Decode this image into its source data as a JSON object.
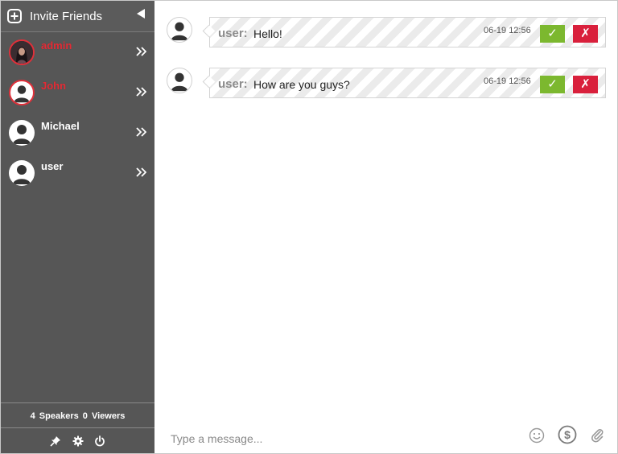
{
  "sidebar": {
    "invite_label": "Invite Friends",
    "users": [
      {
        "name": "admin",
        "highlight": true
      },
      {
        "name": "John",
        "highlight": true
      },
      {
        "name": "Michael",
        "highlight": false
      },
      {
        "name": "user",
        "highlight": false
      }
    ],
    "stats": {
      "speakers_count": "4",
      "speakers_label": "Speakers",
      "viewers_count": "0",
      "viewers_label": "Viewers"
    }
  },
  "messages": [
    {
      "user": "user:",
      "text": "Hello!",
      "time": "06-19 12:56",
      "accept": "✓",
      "reject": "✗"
    },
    {
      "user": "user:",
      "text": "How are you guys?",
      "time": "06-19 12:56",
      "accept": "✓",
      "reject": "✗"
    }
  ],
  "composer": {
    "placeholder": "Type a message..."
  },
  "colors": {
    "sidebar_bg": "#565656",
    "highlight_name": "#e52b35",
    "accept_green": "#7cb82f",
    "reject_red": "#d9203c"
  },
  "icons": [
    "plus-icon",
    "collapse-arrow-icon",
    "chevron-right-icon",
    "pin-icon",
    "gear-icon",
    "power-icon",
    "emoji-icon",
    "dollar-icon",
    "paperclip-icon",
    "user-silhouette-icon"
  ]
}
